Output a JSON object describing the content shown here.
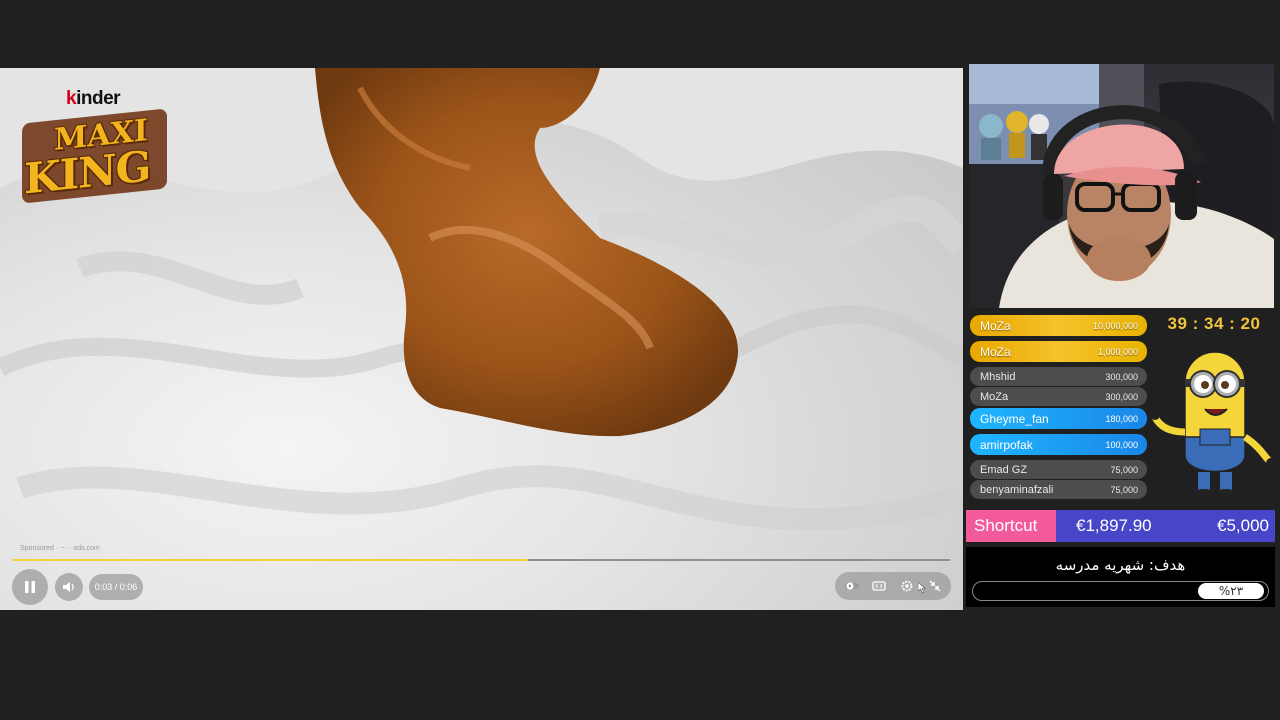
{
  "video": {
    "brand_small": "kinder",
    "brand_line1": "MAXI",
    "brand_line2": "KING",
    "sponsored_text": "Sponsored · ⋯ · ads.com",
    "time": "0:03 / 0:06",
    "progress": 0.55,
    "controls": [
      "pause-icon",
      "volume-icon",
      "autoplay-icon",
      "captions-icon",
      "settings-icon",
      "fullscreen-exit-icon"
    ]
  },
  "leaderboard": [
    {
      "name": "MoZa",
      "amount": "10,000,000",
      "tier": "gold"
    },
    {
      "name": "MoZa",
      "amount": "1,000,000",
      "tier": "gold"
    },
    {
      "name": "Mhshid",
      "amount": "300,000",
      "tier": "gray"
    },
    {
      "name": "MoZa",
      "amount": "300,000",
      "tier": "gray"
    },
    {
      "name": "Gheyme_fan",
      "amount": "180,000",
      "tier": "blue"
    },
    {
      "name": "amirpofak",
      "amount": "100,000",
      "tier": "blue"
    },
    {
      "name": "Emad GZ",
      "amount": "75,000",
      "tier": "gray"
    },
    {
      "name": "benyaminafzali",
      "amount": "75,000",
      "tier": "gray"
    }
  ],
  "timer": "39 : 34 : 20",
  "donation": {
    "label": "Shortcut",
    "current": "€1,897.90",
    "goal": "€5,000"
  },
  "goal": {
    "title": "هدف: شهریه مدرسه",
    "percent_label": "%۲۳"
  },
  "colors": {
    "gold": "#f6c22b",
    "blue": "#1a86e8",
    "gray": "#4d4d4d",
    "pink": "#f25a9c",
    "indigo": "#4746c9",
    "timer": "#f2c53d"
  }
}
